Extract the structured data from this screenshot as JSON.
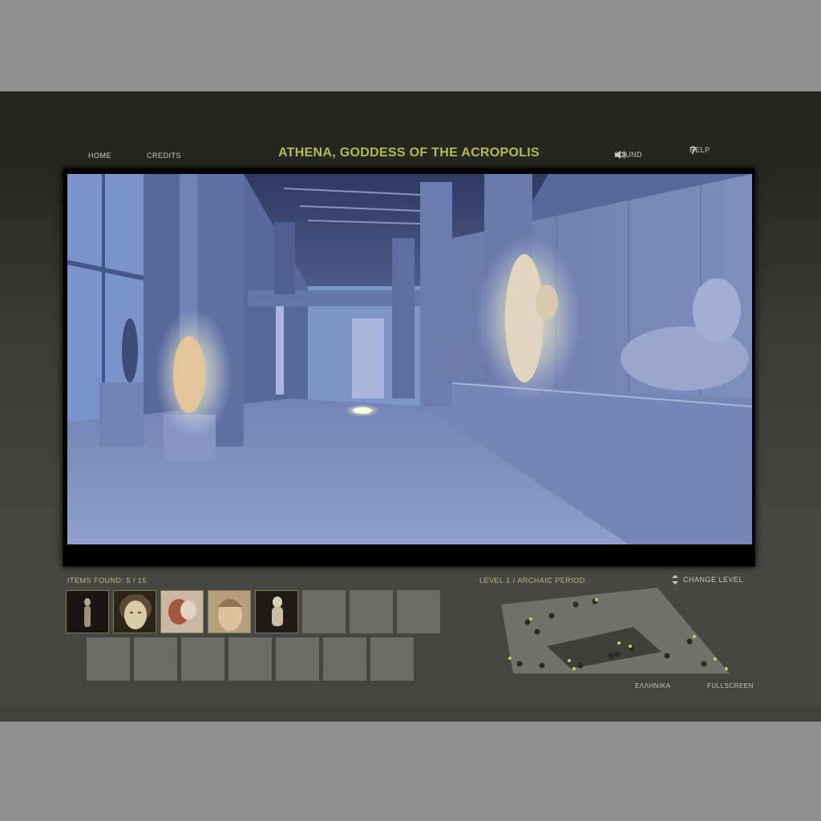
{
  "header": {
    "title": "ATHENA, GODDESS OF THE ACROPOLIS",
    "home_label": "HOME",
    "credits_label": "CREDITS",
    "sound_label": "SOUND",
    "help_label": "HELP",
    "help_glyph": "?"
  },
  "status": {
    "items_found_label": "ITEMS FOUND: 5 / 15",
    "items_found": 5,
    "items_total": 15,
    "level_label": "LEVEL 1 / ARCHAIC PERIOD",
    "change_level_label": "CHANGE LEVEL"
  },
  "inventory": {
    "found_items": [
      {
        "icon": "statue-silhouette-thumbnail"
      },
      {
        "icon": "kore-head-thumbnail"
      },
      {
        "icon": "relief-fragment-thumbnail"
      },
      {
        "icon": "kore-face-thumbnail"
      },
      {
        "icon": "seated-statue-thumbnail"
      }
    ],
    "empty_slots": 10
  },
  "footer": {
    "language_label": "ΕΛΛΗΝΙΚΑ",
    "fullscreen_label": "FULLSCREEN"
  },
  "colors": {
    "title": "#b4bb4d",
    "hud_text": "#b9b977",
    "scene_tint": "#4a5e94",
    "glow": "#fff6c8"
  }
}
